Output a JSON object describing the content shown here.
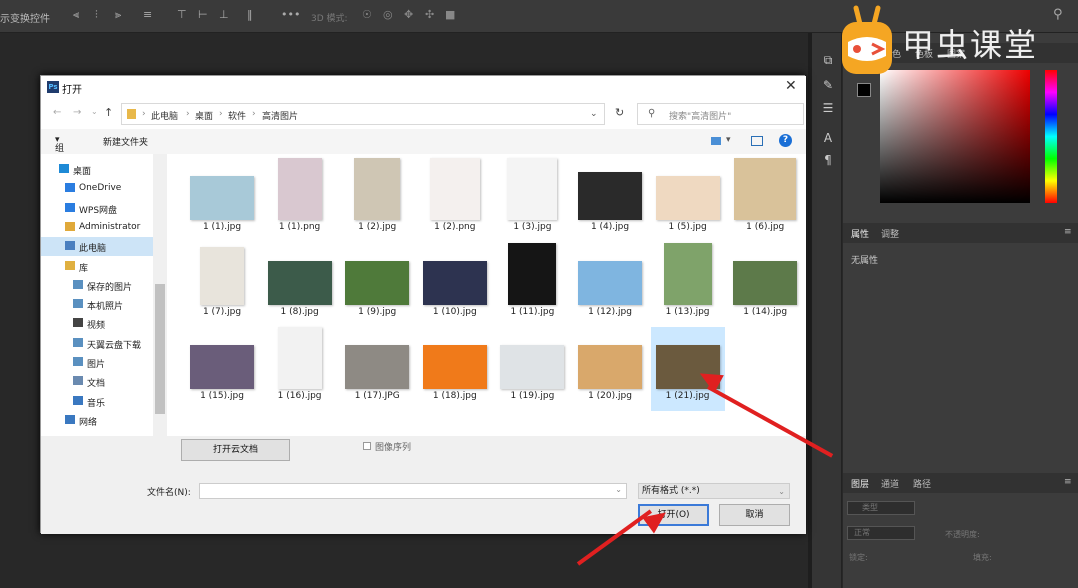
{
  "ps_top": {
    "label": "示变换控件",
    "mode3d": "3D 模式:"
  },
  "watermark": {
    "text": "甲虫课堂"
  },
  "panels": {
    "color_tabs": [
      "颜色",
      "色板",
      "图案"
    ],
    "props_tabs": [
      "属性",
      "调整"
    ],
    "props_empty": "无属性",
    "layers_tabs": [
      "图层",
      "通道",
      "路径"
    ],
    "layer_kind": "类型",
    "blend": "正常",
    "opacity_label": "不透明度:",
    "lock_label": "锁定:",
    "fill_label": "填充:"
  },
  "dialog": {
    "title": "打开",
    "breadcrumb": [
      "此电脑",
      "桌面",
      "软件",
      "高清图片"
    ],
    "search_placeholder": "搜索\"高清图片\"",
    "organize": "组织",
    "new_folder": "新建文件夹",
    "nav": [
      {
        "label": "桌面",
        "icon": "desktop-icon"
      },
      {
        "label": "OneDrive",
        "icon": "cloud-icon"
      },
      {
        "label": "WPS网盘",
        "icon": "cloud-icon"
      },
      {
        "label": "Administrator",
        "icon": "user-icon"
      },
      {
        "label": "此电脑",
        "icon": "computer-icon"
      },
      {
        "label": "库",
        "icon": "library-icon"
      },
      {
        "label": "保存的图片",
        "icon": "pictures-icon"
      },
      {
        "label": "本机照片",
        "icon": "pictures-icon"
      },
      {
        "label": "视频",
        "icon": "video-icon"
      },
      {
        "label": "天翼云盘下载",
        "icon": "download-icon"
      },
      {
        "label": "图片",
        "icon": "pictures-icon"
      },
      {
        "label": "文档",
        "icon": "document-icon"
      },
      {
        "label": "音乐",
        "icon": "music-icon"
      },
      {
        "label": "网络",
        "icon": "network-icon"
      }
    ],
    "files": [
      {
        "name": "1 (1).jpg",
        "color": "#a8c9d8"
      },
      {
        "name": "1 (1).png",
        "color": "#d9c8d0"
      },
      {
        "name": "1 (2).jpg",
        "color": "#cfc6b4"
      },
      {
        "name": "1 (2).png",
        "color": "#f4f0ee"
      },
      {
        "name": "1 (3).jpg",
        "color": "#f4f4f4"
      },
      {
        "name": "1 (4).jpg",
        "color": "#2a2a2a"
      },
      {
        "name": "1 (5).jpg",
        "color": "#efd9c1"
      },
      {
        "name": "1 (6).jpg",
        "color": "#d9c29a"
      },
      {
        "name": "1 (7).jpg",
        "color": "#e8e4dc"
      },
      {
        "name": "1 (8).jpg",
        "color": "#3c5b4a"
      },
      {
        "name": "1 (9).jpg",
        "color": "#4f7a3a"
      },
      {
        "name": "1 (10).jpg",
        "color": "#2d3350"
      },
      {
        "name": "1 (11).jpg",
        "color": "#151515"
      },
      {
        "name": "1 (12).jpg",
        "color": "#7fb5e0"
      },
      {
        "name": "1 (13).jpg",
        "color": "#7fa36a"
      },
      {
        "name": "1 (14).jpg",
        "color": "#5d7a4a"
      },
      {
        "name": "1 (15).jpg",
        "color": "#6a5d7a"
      },
      {
        "name": "1 (16).jpg",
        "color": "#f2f2f2"
      },
      {
        "name": "1 (17).JPG",
        "color": "#8e8a84"
      },
      {
        "name": "1 (18).jpg",
        "color": "#f07a1a"
      },
      {
        "name": "1 (19).jpg",
        "color": "#dfe3e6"
      },
      {
        "name": "1 (20).jpg",
        "color": "#d9a86b"
      },
      {
        "name": "1 (21).jpg",
        "color": "#6b5a3e"
      }
    ],
    "open_cloud": "打开云文档",
    "image_sequence": "图像序列",
    "filename_label": "文件名(N):",
    "filetype": "所有格式 (*.*)",
    "open_btn": "打开(O)",
    "cancel_btn": "取消"
  }
}
